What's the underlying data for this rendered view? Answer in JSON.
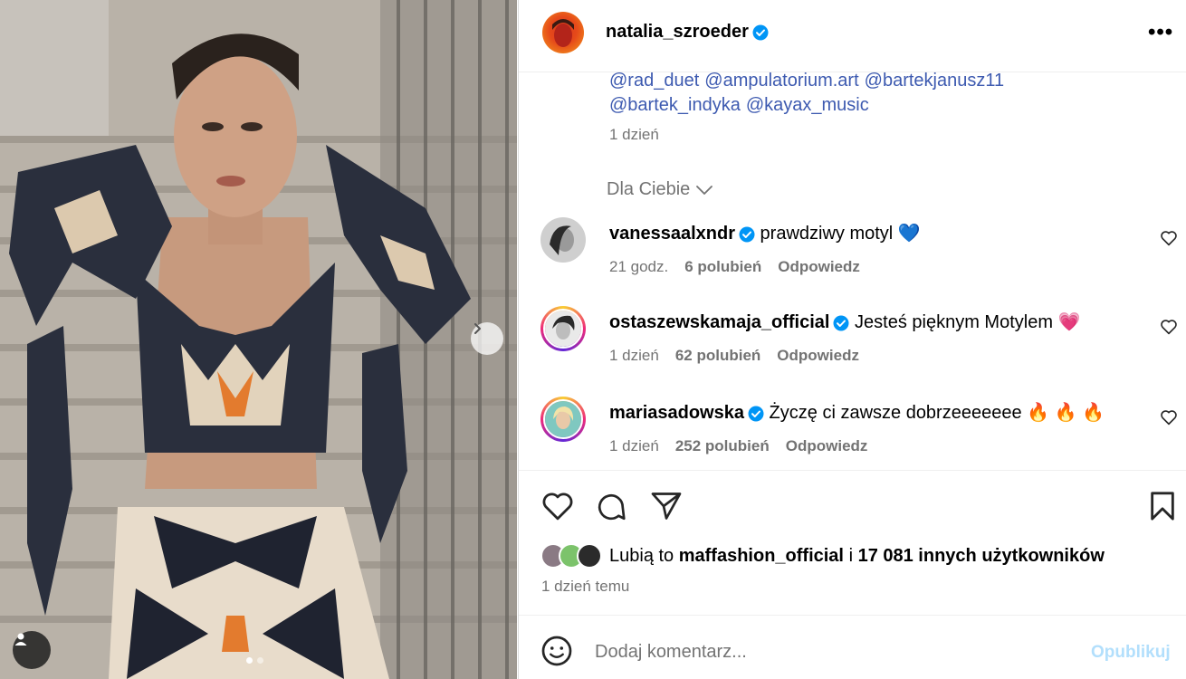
{
  "post": {
    "author": "natalia_szroeder",
    "mentions": [
      "@rad_duet",
      "@ampulatorium.art",
      "@bartekjanusz11",
      "@bartek_indyka",
      "@kayax_music"
    ],
    "caption_time": "1 dzień"
  },
  "section": {
    "for_you_label": "Dla Ciebie"
  },
  "comments": [
    {
      "user": "vanessaalxndr",
      "text": "prawdziwy motyl",
      "emoji": "💙",
      "time": "21 godz.",
      "likes": "6 polubień",
      "reply": "Odpowiedz"
    },
    {
      "user": "ostaszewskamaja_official",
      "text": "Jesteś pięknym Motylem",
      "emoji": "💗",
      "time": "1 dzień",
      "likes": "62 polubień",
      "reply": "Odpowiedz"
    },
    {
      "user": "mariasadowska",
      "text": "Życzę ci zawsze dobrzeeeeeee",
      "emoji": "🔥 🔥 🔥",
      "time": "1 dzień",
      "likes": "252 polubień",
      "reply": "Odpowiedz"
    }
  ],
  "likes": {
    "prefix": "Lubią to",
    "user": "maffashion_official",
    "connector": "i",
    "others": "17 081 innych użytkowników"
  },
  "post_time": "1 dzień temu",
  "composer": {
    "placeholder": "Dodaj komentarz...",
    "publish_label": "Opublikuj"
  },
  "colors": {
    "link": "#3d5ab0",
    "verified": "#0095f6",
    "muted": "#737373",
    "publish_disabled": "#b2dffc"
  },
  "icons": [
    "verified-icon",
    "more-options-icon",
    "chevron-down-icon",
    "heart-icon",
    "comment-icon",
    "share-icon",
    "bookmark-icon",
    "emoji-icon",
    "chevron-right-icon",
    "user-tag-icon"
  ]
}
